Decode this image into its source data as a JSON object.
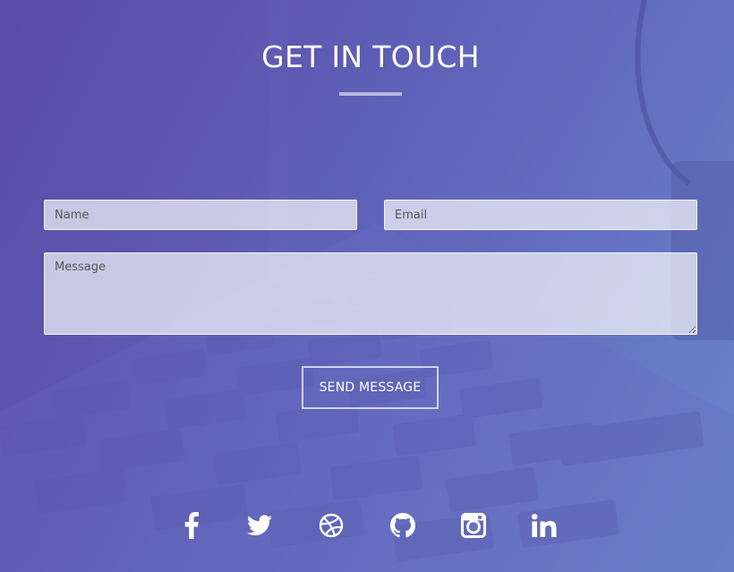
{
  "contact": {
    "title": "GET IN TOUCH",
    "name_placeholder": "Name",
    "email_placeholder": "Email",
    "message_placeholder": "Message",
    "send_label": "SEND MESSAGE"
  },
  "social": [
    {
      "icon": "facebook-icon"
    },
    {
      "icon": "twitter-icon"
    },
    {
      "icon": "dribbble-icon"
    },
    {
      "icon": "github-icon"
    },
    {
      "icon": "instagram-icon"
    },
    {
      "icon": "linkedin-icon"
    }
  ],
  "colors": {
    "background_start": "#5a4fa4",
    "background_end": "#6c86cc",
    "text": "#ffffff",
    "field_background": "rgba(255,255,255,0.68)"
  }
}
